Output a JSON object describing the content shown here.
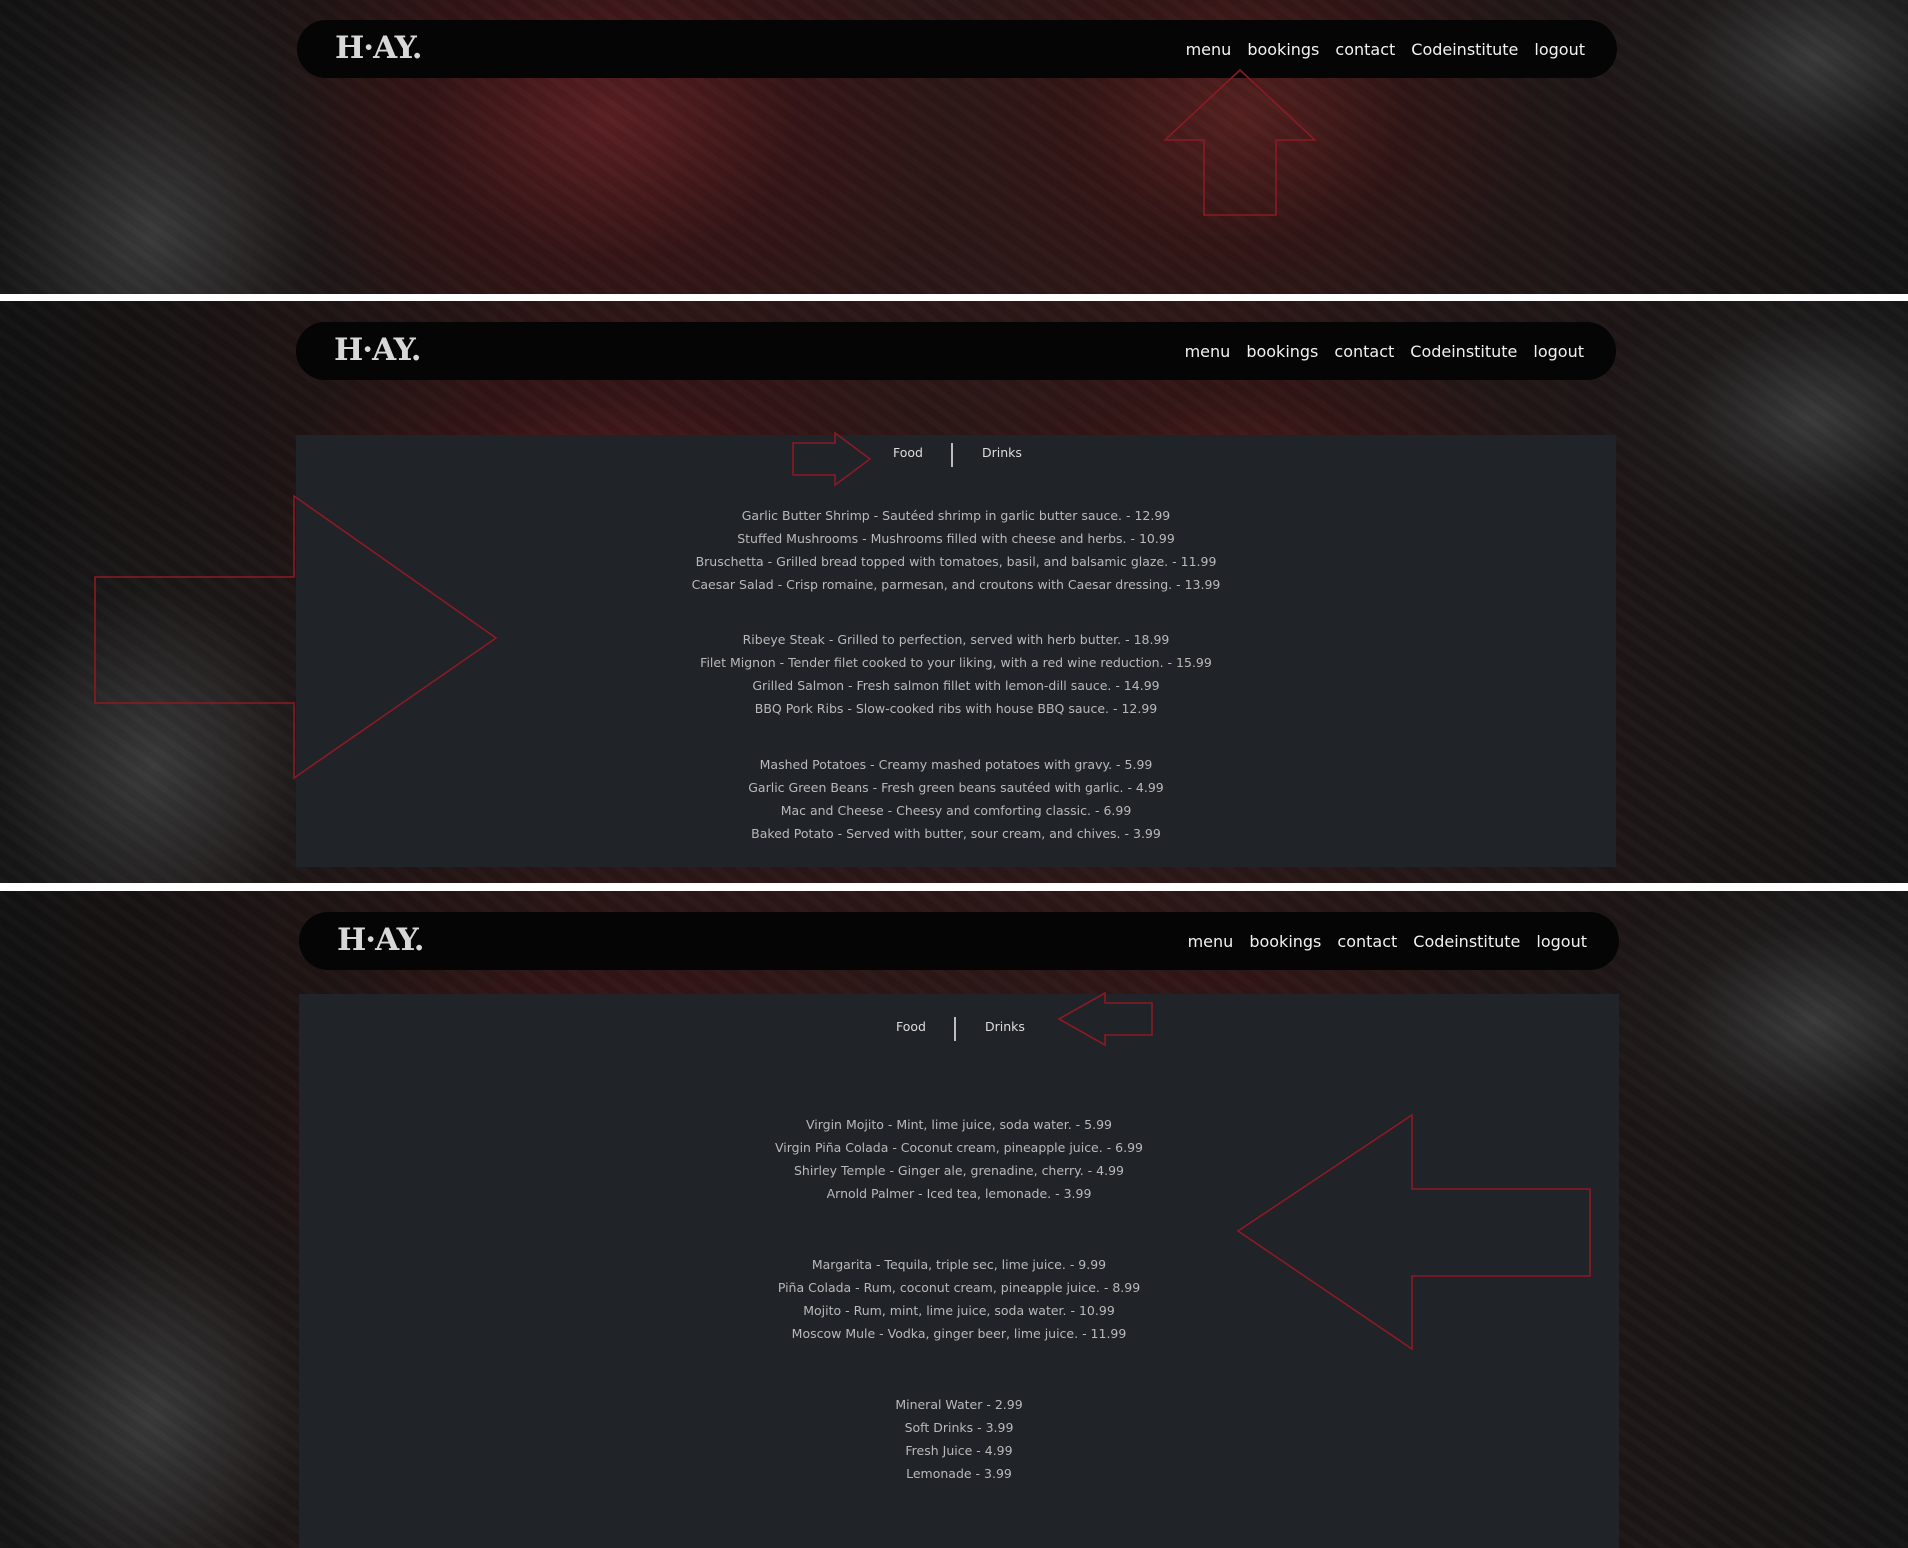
{
  "brand": {
    "logo": "H·AY."
  },
  "nav": [
    "menu",
    "bookings",
    "contact",
    "Codeinstitute",
    "logout"
  ],
  "tabs": {
    "food": "Food",
    "drinks": "Drinks"
  },
  "food_sections": [
    [
      "Garlic Butter Shrimp - Sautéed shrimp in garlic butter sauce. - 12.99",
      "Stuffed Mushrooms - Mushrooms filled with cheese and herbs. - 10.99",
      "Bruschetta - Grilled bread topped with tomatoes, basil, and balsamic glaze. - 11.99",
      "Caesar Salad - Crisp romaine, parmesan, and croutons with Caesar dressing. - 13.99"
    ],
    [
      "Ribeye Steak - Grilled to perfection, served with herb butter. - 18.99",
      "Filet Mignon - Tender filet cooked to your liking, with a red wine reduction. - 15.99",
      "Grilled Salmon - Fresh salmon fillet with lemon-dill sauce. - 14.99",
      "BBQ Pork Ribs - Slow-cooked ribs with house BBQ sauce. - 12.99"
    ],
    [
      "Mashed Potatoes - Creamy mashed potatoes with gravy. - 5.99",
      "Garlic Green Beans - Fresh green beans sautéed with garlic. - 4.99",
      "Mac and Cheese - Cheesy and comforting classic. - 6.99",
      "Baked Potato - Served with butter, sour cream, and chives. - 3.99"
    ]
  ],
  "drink_sections": [
    [
      "Virgin Mojito - Mint, lime juice, soda water. - 5.99",
      "Virgin Piña Colada - Coconut cream, pineapple juice. - 6.99",
      "Shirley Temple - Ginger ale, grenadine, cherry. - 4.99",
      "Arnold Palmer - Iced tea, lemonade. - 3.99"
    ],
    [
      "Margarita - Tequila, triple sec, lime juice. - 9.99",
      "Piña Colada - Rum, coconut cream, pineapple juice. - 8.99",
      "Mojito - Rum, mint, lime juice, soda water. - 10.99",
      "Moscow Mule - Vodka, ginger beer, lime juice. - 11.99"
    ],
    [
      "Mineral Water - 2.99",
      "Soft Drinks - 3.99",
      "Fresh Juice - 4.99",
      "Lemonade - 3.99"
    ]
  ],
  "colors": {
    "navbar": "#050505",
    "menu_panel": "#202328",
    "annotation_arrow": "#8b1a24",
    "separator": "#ffffff"
  },
  "icons": {
    "annotation": "arrow-outline-icon"
  }
}
